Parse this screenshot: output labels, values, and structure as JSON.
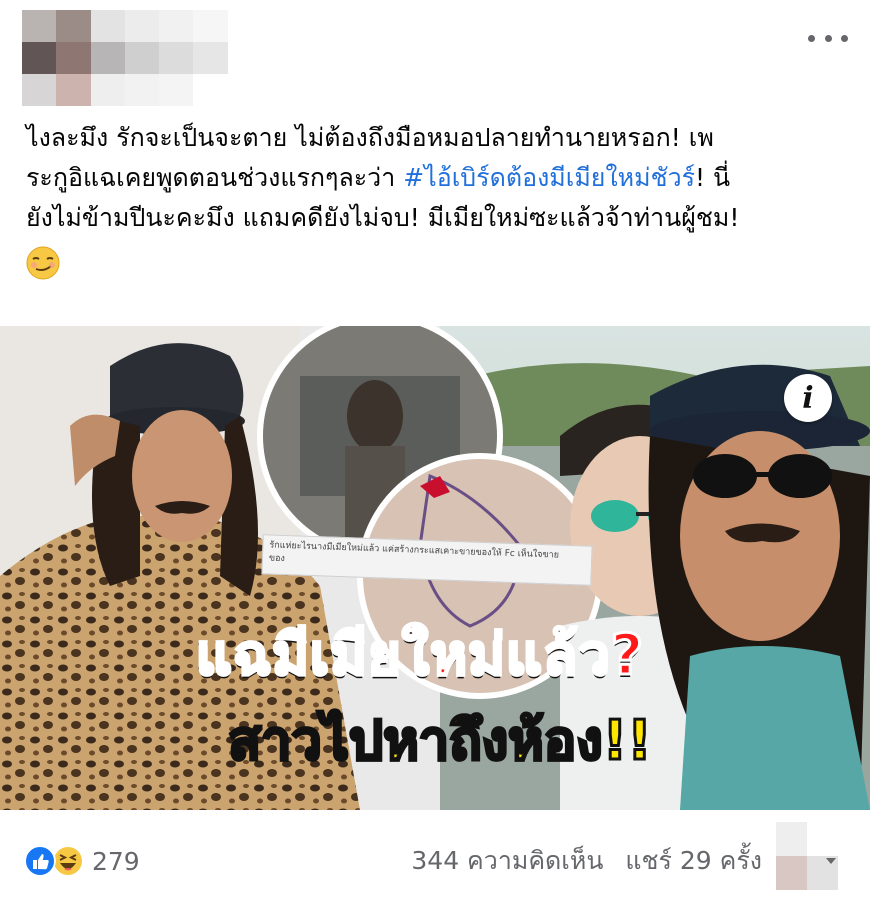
{
  "post": {
    "author_blurred": true,
    "text_lines": [
      "ไงละมึง รักจะเป็นจะตาย ไม่ต้องถึงมือหมอปลายทำนายหรอก! เพ",
      "ระกูอิแฉเคยพูดตอนช่วงแรกๆละว่า ",
      "! นี่",
      "ยังไม่ข้ามปีนะคะมึง แถมคดียังไม่จบ! มีเมียใหม่ซะแล้วจ้าท่านผู้ชม!"
    ],
    "hashtag": "#ไอ้เบิร์ดต้องมีเมียใหม่ชัวร์",
    "emoji": "smirk-emoji"
  },
  "media": {
    "headline": "แฉมีเมียใหม่แล้ว?",
    "subheadline": "สาวไปหาถึงห้อง!!",
    "caption_line1": "รักแห่ยะไรนางมีเมียใหม่แล้ว แค่สร้างกระแสเคาะขายของให้ Fc เห็นใจขาย",
    "caption_line2": "ของ",
    "info_label": "i",
    "headline_color": "#ff1a1a",
    "subheadline_color": "#ffe600"
  },
  "footer": {
    "reaction_count": "279",
    "comments": "344 ความคิดเห็น",
    "shares": "แชร์ 29 ครั้ง",
    "like_color": "#1877f2",
    "haha_color": "#f7c844",
    "muted_color": "#65676b"
  }
}
